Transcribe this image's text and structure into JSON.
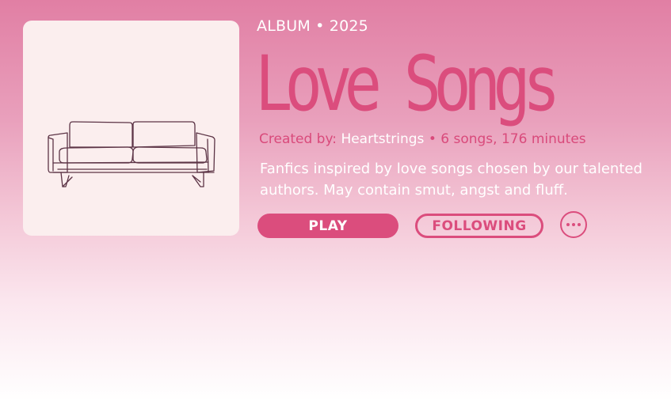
{
  "album": {
    "meta": "ALBUM • 2025",
    "title": "Love Songs",
    "credits": {
      "prefix": "Created by:",
      "author": "Heartstrings",
      "stats": "• 6 songs, 176 minutes"
    },
    "description": "Fanfics inspired by love songs chosen by our talented authors. May contain smut, angst and fluff.",
    "cover_icon": "couch-illustration"
  },
  "actions": {
    "play_label": "PLAY",
    "follow_label": "FOLLOWING",
    "more_icon": "ellipsis-icon"
  },
  "colors": {
    "accent": "#db4d7d",
    "cover_bg": "#fbeeee",
    "gradient_top": "#e17fa4",
    "gradient_bottom": "#ffffff"
  }
}
